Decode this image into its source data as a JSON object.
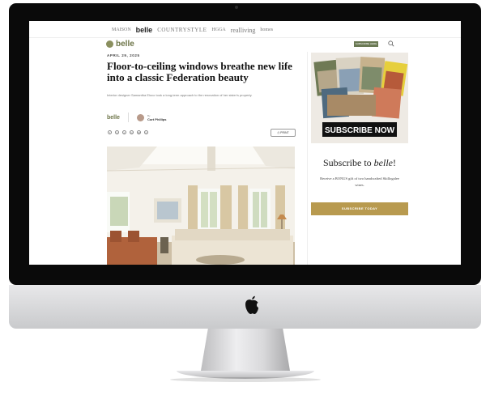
{
  "nav": {
    "brands": [
      "MAISON",
      "belle",
      "COUNTRYSTYLE",
      "HGGA",
      "realliving",
      "homes"
    ]
  },
  "site": {
    "logo": "belle",
    "subscribe_label": "SUBSCRIBE HERE"
  },
  "article": {
    "date": "APRIL 29, 2025",
    "headline": "Floor-to-ceiling windows breathe new life into a classic Federation beauty",
    "dek": "Interior designer Samantha Eloco took a long-term approach to the renovation of her sister's property.",
    "brand_mark": "belle",
    "author_prefix": "By",
    "author": "Cort Phillips",
    "print_label": "PRINT",
    "share_icons": [
      "facebook-icon",
      "x-icon",
      "pinterest-icon",
      "linkedin-icon",
      "email-icon",
      "link-icon"
    ]
  },
  "sidebar": {
    "ad_banner": "SUBSCRIBE NOW",
    "ad_title_prefix": "Subscribe to ",
    "ad_title_brand": "belle",
    "ad_title_suffix": "!",
    "ad_body": "Receive a BONUS gift of two handcrafted Skillogalee wines.",
    "ad_button": "SUBSCRIBE TODAY"
  },
  "colors": {
    "brand_green": "#6d7548",
    "accent_gold": "#b89a4f"
  }
}
